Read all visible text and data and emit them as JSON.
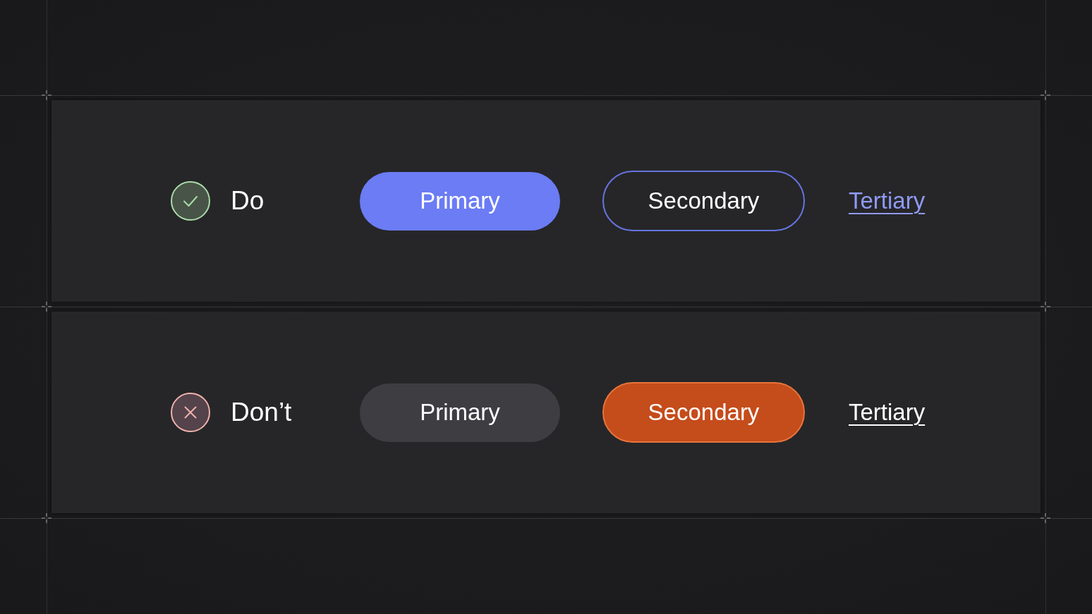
{
  "rows": [
    {
      "kind": "do",
      "label": "Do",
      "buttons": [
        {
          "kind": "primary",
          "label": "Primary"
        },
        {
          "kind": "secondary",
          "label": "Secondary"
        },
        {
          "kind": "tertiary",
          "label": "Tertiary"
        }
      ]
    },
    {
      "kind": "dont",
      "label": "Don’t",
      "buttons": [
        {
          "kind": "primary",
          "label": "Primary"
        },
        {
          "kind": "secondary",
          "label": "Secondary"
        },
        {
          "kind": "tertiary",
          "label": "Tertiary"
        }
      ]
    }
  ]
}
